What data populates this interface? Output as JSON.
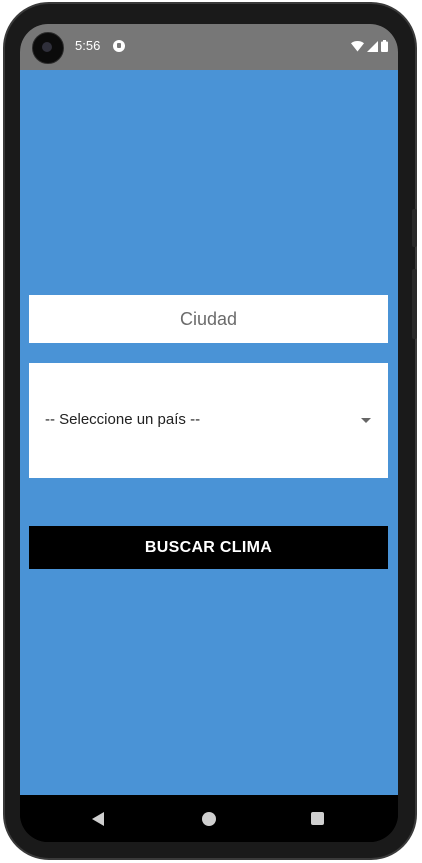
{
  "status_bar": {
    "time": "5:56",
    "icons": [
      "camera-cutout",
      "notification-icon",
      "wifi-icon",
      "signal-icon",
      "battery-icon"
    ]
  },
  "form": {
    "city": {
      "value": "",
      "placeholder": "Ciudad"
    },
    "country": {
      "selected": "-- Seleccione un país --"
    },
    "search_button_label": "BUSCAR CLIMA"
  },
  "nav_bar": {
    "icons": [
      "back-icon",
      "home-icon",
      "recent-apps-icon"
    ]
  },
  "colors": {
    "app_background": "#4a93d6",
    "status_bar": "#777777",
    "button": "#000000",
    "button_text": "#ffffff",
    "input_background": "#ffffff"
  }
}
